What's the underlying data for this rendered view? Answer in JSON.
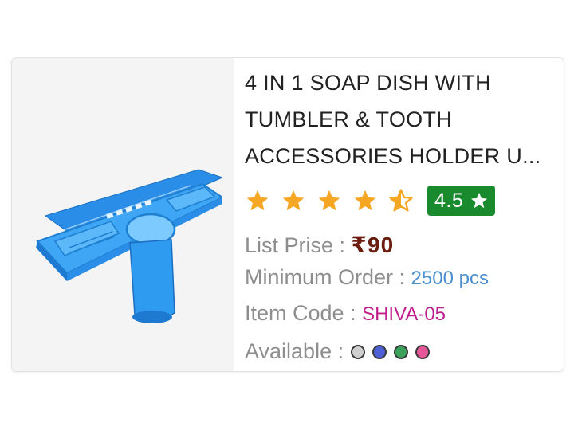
{
  "product": {
    "title": "4 IN 1 SOAP DISH WITH TUMBLER & TOOTH ACCESSORIES HOLDER U...",
    "rating": 4.5,
    "rating_text": "4.5",
    "list_price_label": "List Prise : ",
    "list_price_value": "₹90",
    "min_order_label": "Minimum Order : ",
    "min_order_value": "2500 pcs",
    "item_code_label": "Item Code : ",
    "item_code_value": "SHIVA-05",
    "available_label": "Available : ",
    "available_colors": [
      "#cfcfcf",
      "#4f5fd6",
      "#3aa05a",
      "#e8569a"
    ],
    "image_icon": "soap-dish-product-image"
  },
  "colors": {
    "star": "#f5a623",
    "badge": "#1a8a2e",
    "price": "#6b1e10",
    "min_order": "#4a8fd0",
    "item_code": "#c0208e"
  }
}
